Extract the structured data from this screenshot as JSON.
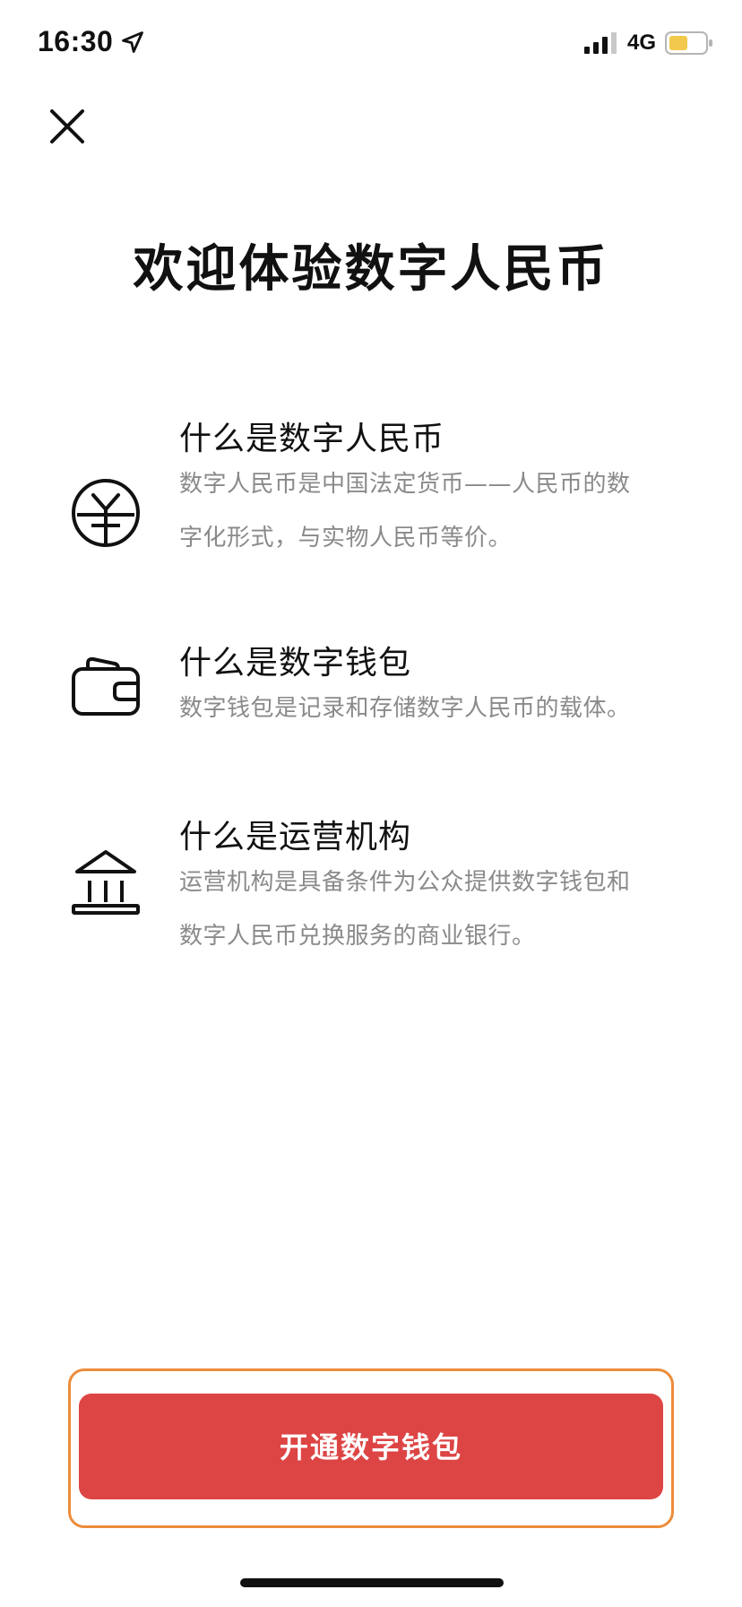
{
  "status_bar": {
    "time": "16:30",
    "network": "4G",
    "battery_color": "#f2c94c"
  },
  "header": {
    "close_icon": "close-icon"
  },
  "title": "欢迎体验数字人民币",
  "sections": [
    {
      "icon": "digital-yuan-icon",
      "heading": "什么是数字人民币",
      "description": "数字人民币是中国法定货币——人民币的数字化形式，与实物人民币等价。"
    },
    {
      "icon": "wallet-icon",
      "heading": "什么是数字钱包",
      "description": "数字钱包是记录和存储数字人民币的载体。"
    },
    {
      "icon": "bank-icon",
      "heading": "什么是运营机构",
      "description": "运营机构是具备条件为公众提供数字钱包和数字人民币兑换服务的商业银行。"
    }
  ],
  "primary_action": {
    "label": "开通数字钱包",
    "color": "#dd4544",
    "highlight_color": "#ec8c3a"
  }
}
